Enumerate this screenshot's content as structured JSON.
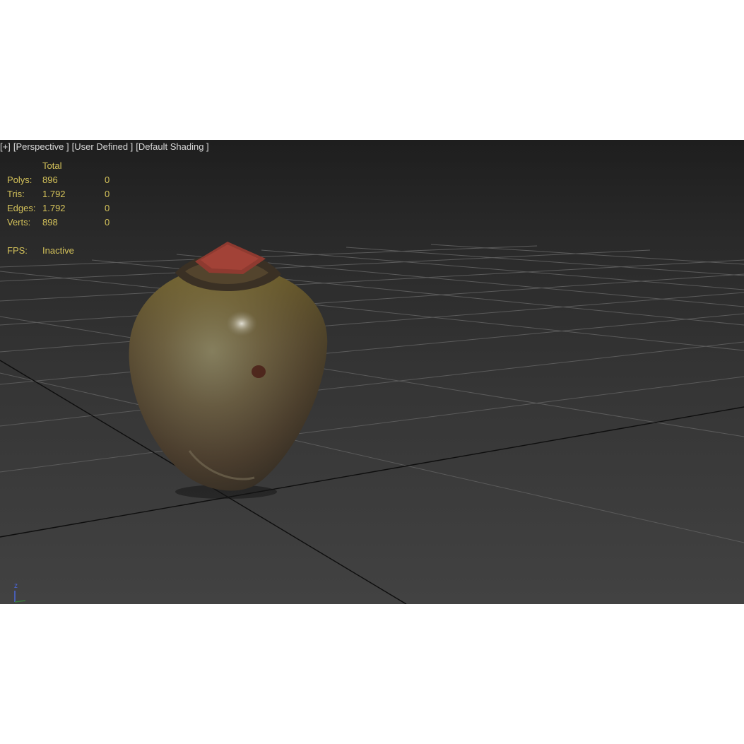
{
  "viewport": {
    "labels": [
      "[+]",
      "[Perspective ]",
      "[User Defined ]",
      "[Default Shading ]"
    ]
  },
  "stats": {
    "header_total": "Total",
    "rows": [
      {
        "label": "Polys:",
        "total": "896",
        "selected": "0"
      },
      {
        "label": "Tris:",
        "total": "1.792",
        "selected": "0"
      },
      {
        "label": "Edges:",
        "total": "1.792",
        "selected": "0"
      },
      {
        "label": "Verts:",
        "total": "898",
        "selected": "0"
      }
    ],
    "fps_label": "FPS:",
    "fps_value": "Inactive"
  },
  "axis": {
    "z_label": "z"
  },
  "colors": {
    "stats_text": "#d4c25a",
    "label_text": "#d8d8d8",
    "grid_line": "#5b5b5b",
    "axis_line": "#0e0e0e"
  },
  "icons": [
    "axis-gizmo-icon"
  ]
}
